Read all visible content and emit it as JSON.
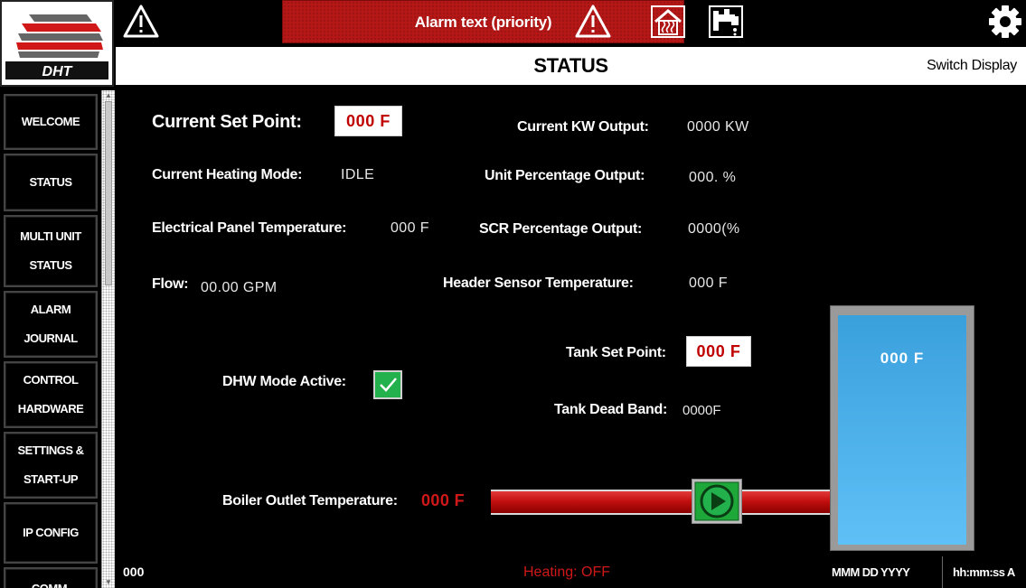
{
  "header": {
    "logo_text": "DHT",
    "alarm_text": "Alarm text (priority)",
    "page_title": "STATUS",
    "switch_display_label": "Switch Display"
  },
  "sidebar": {
    "items": [
      {
        "line1": "WELCOME",
        "line2": ""
      },
      {
        "line1": "STATUS",
        "line2": ""
      },
      {
        "line1": "MULTI UNIT",
        "line2": "STATUS"
      },
      {
        "line1": "ALARM",
        "line2": "JOURNAL"
      },
      {
        "line1": "CONTROL",
        "line2": "HARDWARE"
      },
      {
        "line1": "SETTINGS &",
        "line2": "START-UP"
      },
      {
        "line1": "IP CONFIG",
        "line2": ""
      },
      {
        "line1": "COMM.",
        "line2": ""
      }
    ]
  },
  "status": {
    "current_set_point_label": "Current Set Point:",
    "current_set_point_value": "000  F",
    "current_heating_mode_label": "Current Heating Mode:",
    "current_heating_mode_value": "IDLE",
    "electrical_panel_temp_label": "Electrical Panel Temperature:",
    "electrical_panel_temp_value": "000  F",
    "flow_label": "Flow:",
    "flow_value": "00.00  GPM",
    "current_kw_output_label": "Current KW Output:",
    "current_kw_output_value": "0000  KW",
    "unit_percentage_output_label": "Unit Percentage Output:",
    "unit_percentage_output_value": "000.  %",
    "scr_percentage_output_label": "SCR Percentage Output:",
    "scr_percentage_output_value": "0000(%",
    "header_sensor_temp_label": "Header Sensor Temperature:",
    "header_sensor_temp_value": "000  F",
    "tank_set_point_label": "Tank Set Point:",
    "tank_set_point_value": "000  F",
    "tank_dead_band_label": "Tank Dead Band:",
    "tank_dead_band_value": "0000F",
    "dhw_mode_label": "DHW Mode Active:",
    "dhw_mode_active": true,
    "boiler_outlet_temp_label": "Boiler Outlet Temperature:",
    "boiler_outlet_temp_value": "000  F",
    "tank_temp_value": "000  F"
  },
  "footer": {
    "left_value": "000",
    "heating_status": "Heating: OFF",
    "date": "MMM DD YYYY",
    "time": "hh:mm:ss A"
  },
  "colors": {
    "alarm_red": "#b51717",
    "value_red": "#c00000",
    "pipe_red": "#c40f0f",
    "tank_blue": "#5fc0f6",
    "check_green": "#22b14c",
    "pump_green": "#1fa83a"
  },
  "icons": {
    "alarm_left": "warning-triangle-icon",
    "alarm_right": "warning-triangle-icon",
    "home_heat": "home-heating-icon",
    "faucet": "faucet-icon",
    "settings": "gear-icon",
    "pump": "pump-play-icon",
    "check": "checkmark-icon"
  }
}
